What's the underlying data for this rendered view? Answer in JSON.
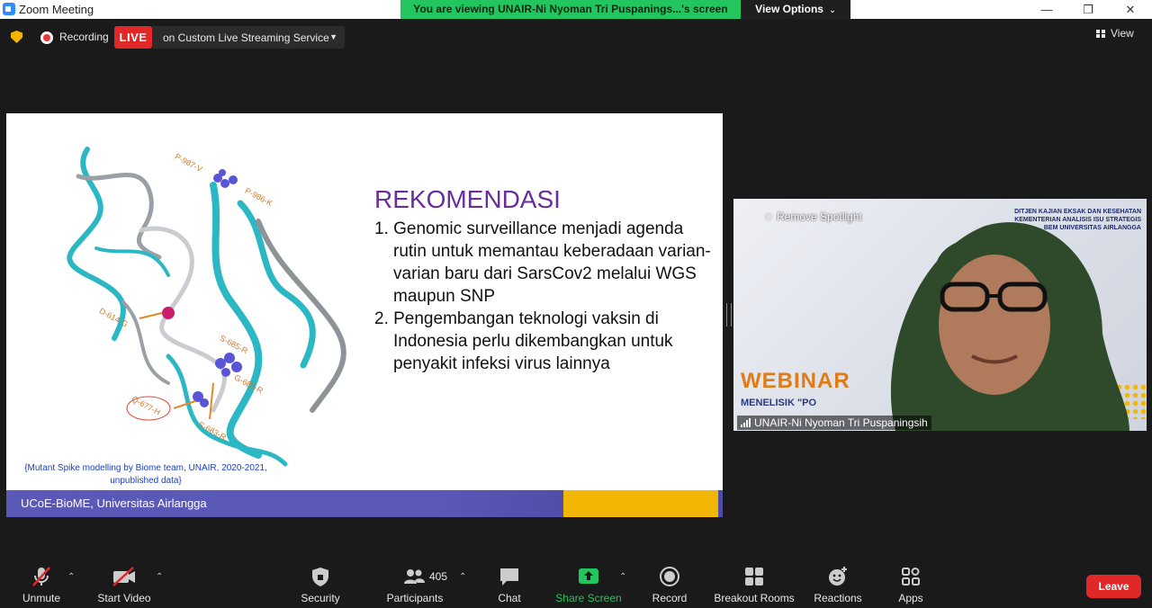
{
  "window": {
    "title": "Zoom Meeting",
    "share_banner": "You are viewing UNAIR-Ni Nyoman Tri Puspanings...'s screen",
    "view_options": "View Options",
    "controls": [
      "—",
      "❐",
      "✕"
    ]
  },
  "status": {
    "recording": "Recording",
    "live_badge": "LIVE",
    "live_service": "on Custom Live Streaming Service",
    "view": "View"
  },
  "slide": {
    "title": "REKOMENDASI",
    "items": [
      "1. Genomic surveillance menjadi agenda rutin untuk memantau keberadaan varian-varian baru dari SarsCov2 melalui WGS maupun SNP",
      "2. Pengembangan teknologi vaksin di Indonesia perlu dikembangkan untuk penyakit infeksi virus lainnya"
    ],
    "mutation_labels": [
      "P-987-V",
      "P-986-K",
      "D-614-G",
      "S-685-R",
      "G-682-R",
      "Q-677-H",
      "S-683-R"
    ],
    "caption": "{Mutant Spike modelling by Biome team, UNAIR, 2020-2021, unpublished data}",
    "footer": "UCoE-BioME, Universitas Airlangga"
  },
  "video": {
    "participant_name": "UNAIR-Ni Nyoman Tri Puspaningsih",
    "remove_spotlight": "Remove Spotlight",
    "bg_text_lines": [
      "DITJEN KAJIAN EKSAK DAN KESEHATAN",
      "KEMENTERIAN ANALISIS ISU STRATEGIS",
      "BEM UNIVERSITAS AIRLANGGA"
    ],
    "bg_webinar": "WEBINAR",
    "bg_menelisik": "MENELISIK \"PO"
  },
  "toolbar": {
    "unmute": "Unmute",
    "start_video": "Start Video",
    "security": "Security",
    "participants": "Participants",
    "participants_count": "405",
    "chat": "Chat",
    "share_screen": "Share Screen",
    "record": "Record",
    "breakout_rooms": "Breakout Rooms",
    "reactions": "Reactions",
    "apps": "Apps",
    "leave": "Leave"
  },
  "colors": {
    "accent_green": "#22c55e",
    "live_red": "#e02828",
    "slide_title_purple": "#6a2d9c",
    "footer_purple": "#5b59b8"
  }
}
